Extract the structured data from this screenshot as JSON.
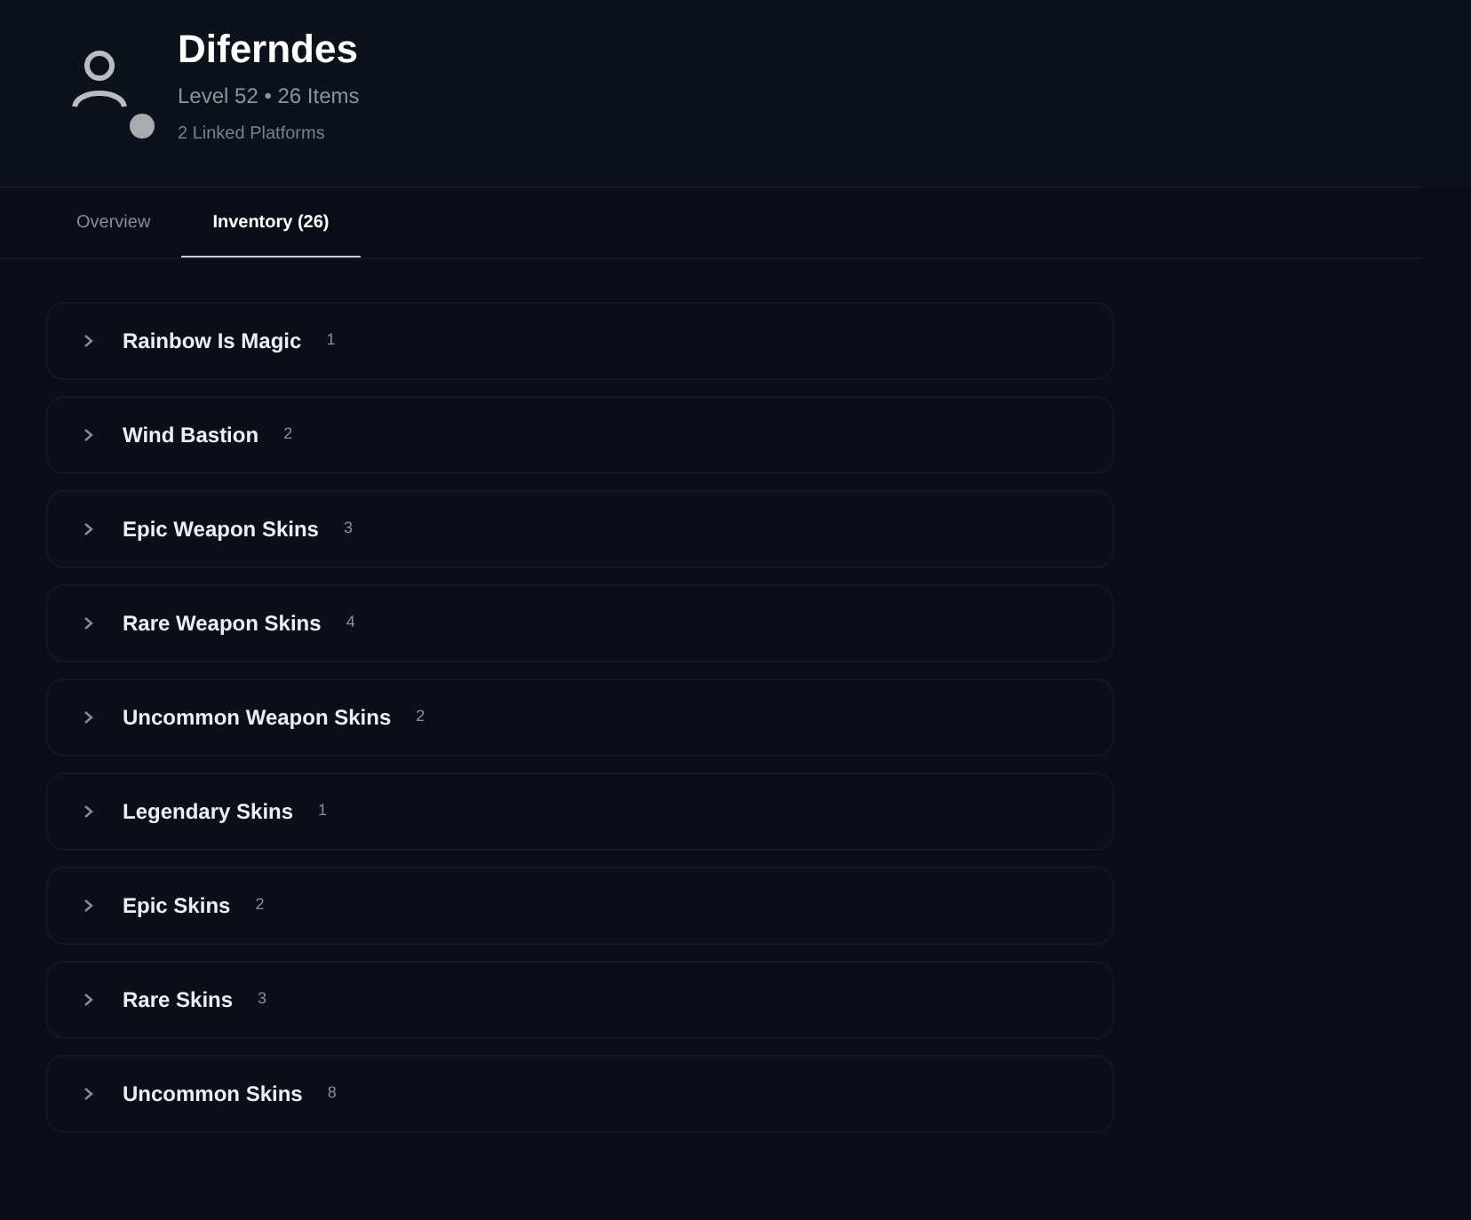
{
  "profile": {
    "name": "Diferndes",
    "stats": "Level 52 • 26 Items",
    "platforms": "2 Linked Platforms"
  },
  "tabs": [
    {
      "label": "Overview",
      "selected": false
    },
    {
      "label": "Inventory (26)",
      "selected": true
    }
  ],
  "categories": [
    {
      "name": "Rainbow Is Magic",
      "count": "1",
      "expanded": false
    },
    {
      "name": "Wind Bastion",
      "count": "2",
      "expanded": false
    },
    {
      "name": "Epic Weapon Skins",
      "count": "3",
      "expanded": false
    },
    {
      "name": "Rare Weapon Skins",
      "count": "4",
      "expanded": false
    },
    {
      "name": "Uncommon Weapon Skins",
      "count": "2",
      "expanded": false
    },
    {
      "name": "Legendary Skins",
      "count": "1",
      "expanded": false
    },
    {
      "name": "Epic Skins",
      "count": "2",
      "expanded": false
    },
    {
      "name": "Rare Skins",
      "count": "3",
      "expanded": false
    },
    {
      "name": "Uncommon Skins",
      "count": "8",
      "expanded": false
    }
  ]
}
